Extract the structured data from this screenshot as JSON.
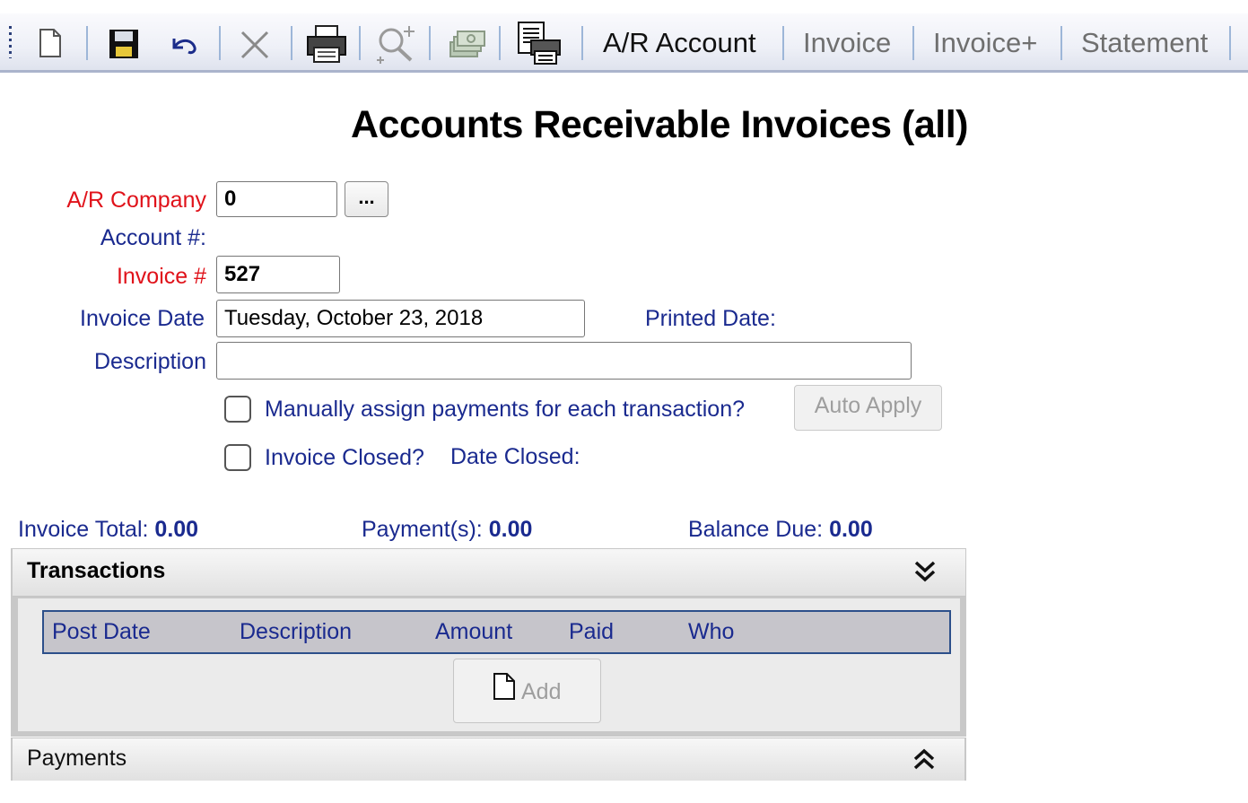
{
  "toolbar": {
    "icons": [
      "new-doc-icon",
      "save-icon",
      "undo-icon",
      "delete-icon",
      "print-icon",
      "search-icon",
      "money-icon",
      "report-icon"
    ],
    "tabs": [
      {
        "label": "A/R Account",
        "active": true
      },
      {
        "label": "Invoice",
        "active": false
      },
      {
        "label": "Invoice+",
        "active": false
      },
      {
        "label": "Statement",
        "active": false
      }
    ]
  },
  "page": {
    "title": "Accounts Receivable Invoices (all)"
  },
  "form": {
    "company_label": "A/R Company",
    "company_value": "0",
    "lookup_label": "...",
    "account_label": "Account #:",
    "invoice_no_label": "Invoice #",
    "invoice_no_value": "527",
    "invoice_date_label": "Invoice Date",
    "invoice_date_value": "Tuesday, October 23, 2018",
    "printed_date_label": "Printed Date:",
    "description_label": "Description",
    "description_value": "",
    "manual_assign_label": "Manually assign payments for each transaction?",
    "auto_apply_label": "Auto Apply",
    "invoice_closed_label": "Invoice Closed?",
    "date_closed_label": "Date Closed:"
  },
  "totals": {
    "invoice_total_label": "Invoice Total:",
    "invoice_total_value": "0.00",
    "payments_label": "Payment(s):",
    "payments_value": "0.00",
    "balance_label": "Balance Due:",
    "balance_value": "0.00"
  },
  "transactions": {
    "title": "Transactions",
    "columns": [
      "Post Date",
      "Description",
      "Amount",
      "Paid",
      "Who"
    ],
    "add_label": "Add"
  },
  "payments": {
    "title": "Payments"
  },
  "colors": {
    "label_blue": "#1a2a8f",
    "required_red": "#e0121a",
    "grid_border": "#2c4f8a"
  }
}
